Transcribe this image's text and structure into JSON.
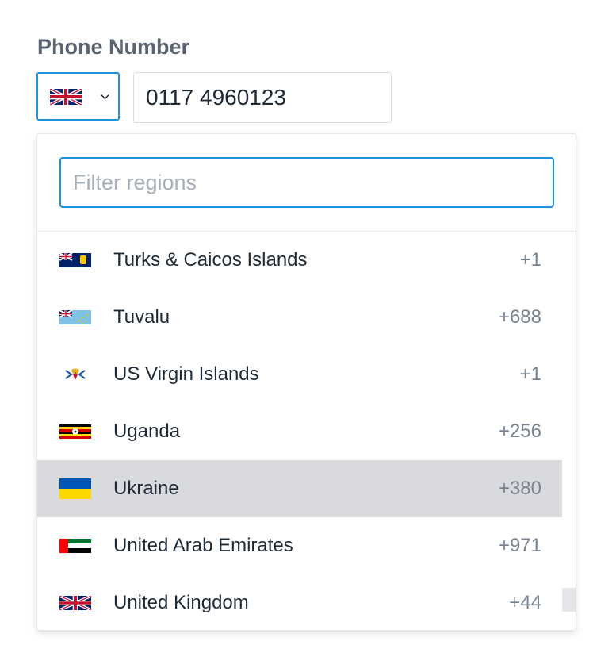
{
  "field": {
    "label": "Phone Number",
    "selected_region_flag": "gb-flag",
    "phone_value": "0117 4960123"
  },
  "dropdown": {
    "filter_placeholder": "Filter regions",
    "filter_value": "",
    "regions": [
      {
        "name": "Turks & Caicos Islands",
        "code": "+1",
        "flag": "tc-flag"
      },
      {
        "name": "Tuvalu",
        "code": "+688",
        "flag": "tv-flag"
      },
      {
        "name": "US Virgin Islands",
        "code": "+1",
        "flag": "vi-flag"
      },
      {
        "name": "Uganda",
        "code": "+256",
        "flag": "ug-flag"
      },
      {
        "name": "Ukraine",
        "code": "+380",
        "flag": "ua-flag",
        "highlighted": true
      },
      {
        "name": "United Arab Emirates",
        "code": "+971",
        "flag": "ae-flag"
      },
      {
        "name": "United Kingdom",
        "code": "+44",
        "flag": "gb-flag"
      }
    ]
  },
  "colors": {
    "accent": "#1d93e0",
    "highlight_row": "#d8dade"
  }
}
